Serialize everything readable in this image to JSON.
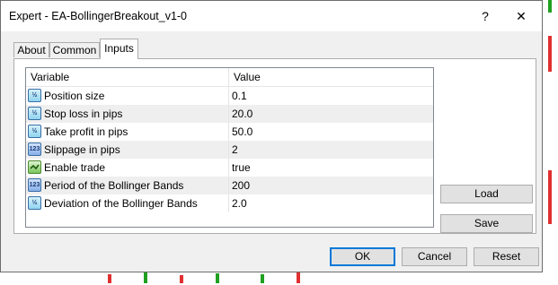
{
  "window": {
    "title": "Expert - EA-BollingerBreakout_v1-0",
    "help_glyph": "?",
    "close_glyph": "✕"
  },
  "tabs": [
    {
      "label": "About"
    },
    {
      "label": "Common"
    },
    {
      "label": "Inputs"
    }
  ],
  "active_tab": "Inputs",
  "grid": {
    "col_variable": "Variable",
    "col_value": "Value",
    "rows": [
      {
        "icon": "fraction-icon",
        "icon_text": "½",
        "name": "Position size",
        "value": "0.1"
      },
      {
        "icon": "fraction-icon",
        "icon_text": "½",
        "name": "Stop loss in pips",
        "value": "20.0"
      },
      {
        "icon": "fraction-icon",
        "icon_text": "½",
        "name": "Take profit in pips",
        "value": "50.0"
      },
      {
        "icon": "integer-icon",
        "icon_text": "123",
        "name": "Slippage in pips",
        "value": "2"
      },
      {
        "icon": "boolean-icon",
        "icon_text": "",
        "name": "Enable trade",
        "value": "true"
      },
      {
        "icon": "integer-icon",
        "icon_text": "123",
        "name": "Period of the Bollinger Bands",
        "value": "200"
      },
      {
        "icon": "fraction-icon",
        "icon_text": "½",
        "name": "Deviation of the Bollinger Bands",
        "value": "2.0"
      }
    ]
  },
  "side_buttons": {
    "load": "Load",
    "save": "Save"
  },
  "footer_buttons": {
    "ok": "OK",
    "cancel": "Cancel",
    "reset": "Reset"
  },
  "colors": {
    "accent": "#0078d7",
    "candle_up": "#20a020",
    "candle_down": "#e03030"
  }
}
